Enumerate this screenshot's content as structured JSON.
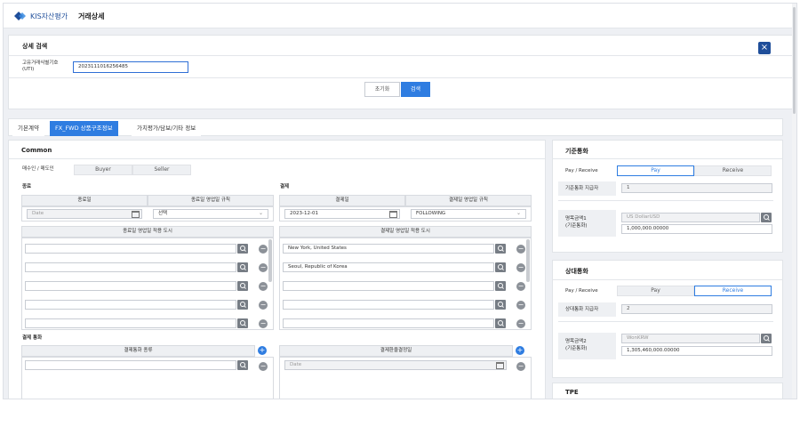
{
  "header": {
    "brand": "KIS자산평가",
    "title": "거래상세"
  },
  "search": {
    "title": "상세 검색",
    "uti_label_1": "고유거래식별기호",
    "uti_label_2": "(UTI)",
    "uti_value": "2023111016256485",
    "reset": "초기화",
    "submit": "검색"
  },
  "tabs": [
    "기본계약",
    "FX_FWD 상품구조정보",
    "가치평가/담보/기타 정보"
  ],
  "common": {
    "title": "Common",
    "buyer_seller_label": "매수인 / 매도인",
    "buyer": "Buyer",
    "seller": "Seller"
  },
  "end": {
    "title": "종료",
    "col_date": "종료일",
    "col_rule": "종료일 영업일 규칙",
    "date_placeholder": "Date",
    "rule_value": "선택",
    "cities_header": "종료일 영업일 적용 도시",
    "cities": [
      "",
      "",
      "",
      "",
      ""
    ]
  },
  "settle": {
    "title": "결제",
    "col_date": "결제일",
    "col_rule": "결제일 영업일 규칙",
    "date_value": "2023-12-01",
    "rule_value": "FOLLOWING",
    "cities_header": "결제일 영업일 적용 도시",
    "cities": [
      "New York, United States",
      "Seoul, Republic of Korea",
      "",
      "",
      ""
    ]
  },
  "currency": {
    "title": "결제 통화",
    "col_type": "결제통화 종류",
    "col_fix": "결제환율결정일",
    "date_placeholder": "Date"
  },
  "base": {
    "title": "기준통화",
    "pay_receive_label": "Pay / Receive",
    "pay": "Pay",
    "receive": "Receive",
    "payer_label": "기준통화 지급자",
    "payer_value": "1",
    "notional_label_1": "명목금액1",
    "notional_label_2": "(기준통화)",
    "ccy_placeholder": "US Dollar",
    "ccy_code": "USD",
    "amount": "1,000,000.00000"
  },
  "counter": {
    "title": "상대통화",
    "pay_receive_label": "Pay / Receive",
    "pay": "Pay",
    "receive": "Receive",
    "payer_label": "상대통화 지급자",
    "payer_value": "2",
    "notional_label_1": "명목금액2",
    "notional_label_2": "(기준통화)",
    "ccy_placeholder": "Won",
    "ccy_code": "KRW",
    "amount": "1,305,460,000.00000"
  },
  "tpe": {
    "title": "TPE"
  },
  "colors": {
    "accent": "#2f7de1",
    "navy": "#1f4e9a"
  }
}
